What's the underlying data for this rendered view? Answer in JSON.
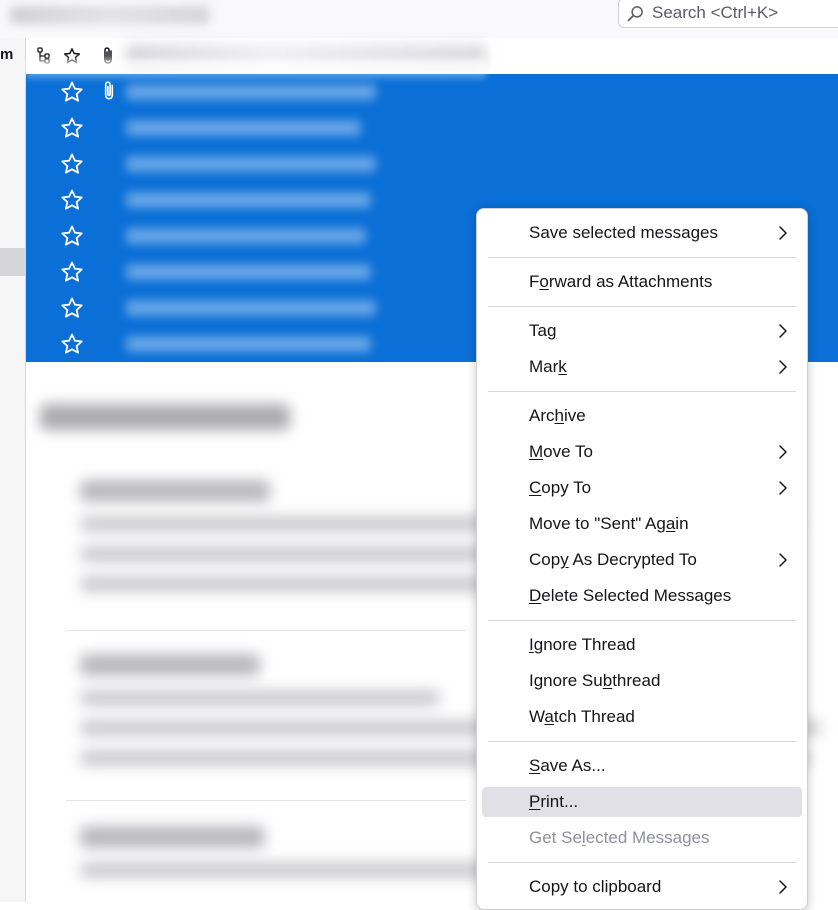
{
  "search": {
    "placeholder": "Search <Ctrl+K>"
  },
  "folder_pane": {
    "label_fragment": "m"
  },
  "list": {
    "row_count": 8,
    "selected_color": "#0a6fd6"
  },
  "context_menu": {
    "items": [
      {
        "id": "save-selected-messages",
        "label": "Save selected messages",
        "submenu": true
      },
      {
        "id": "forward-as-attachments",
        "label": "Forward as Attachments",
        "accesskey_index": 1
      },
      {
        "id": "tag",
        "label": "Tag",
        "submenu": true,
        "accesskey_index": 2
      },
      {
        "id": "mark",
        "label": "Mark",
        "submenu": true,
        "accesskey_index": 3
      },
      {
        "id": "archive",
        "label": "Archive",
        "accesskey_index": 3
      },
      {
        "id": "move-to",
        "label": "Move To",
        "submenu": true,
        "accesskey_index": 0
      },
      {
        "id": "copy-to",
        "label": "Copy To",
        "submenu": true,
        "accesskey_index": 0
      },
      {
        "id": "move-to-sent-again",
        "label": "Move to \"Sent\" Again",
        "accesskey_index": 17
      },
      {
        "id": "copy-as-decrypted-to",
        "label": "Copy As Decrypted To",
        "submenu": true,
        "accesskey_index": 3
      },
      {
        "id": "delete-selected-messages",
        "label": "Delete Selected Messages",
        "accesskey_index": 0
      },
      {
        "id": "ignore-thread",
        "label": "Ignore Thread",
        "accesskey_index": 0
      },
      {
        "id": "ignore-subthread",
        "label": "Ignore Subthread",
        "accesskey_index": 9
      },
      {
        "id": "watch-thread",
        "label": "Watch Thread",
        "accesskey_index": 1
      },
      {
        "id": "save-as",
        "label": "Save As...",
        "accesskey_index": 0
      },
      {
        "id": "print",
        "label": "Print...",
        "accesskey_index": 0,
        "hovered": true
      },
      {
        "id": "get-selected-messages",
        "label": "Get Selected Messages",
        "accesskey_index": 6,
        "disabled": true
      },
      {
        "id": "copy-to-clipboard",
        "label": "Copy to clipboard",
        "submenu": true
      }
    ]
  }
}
